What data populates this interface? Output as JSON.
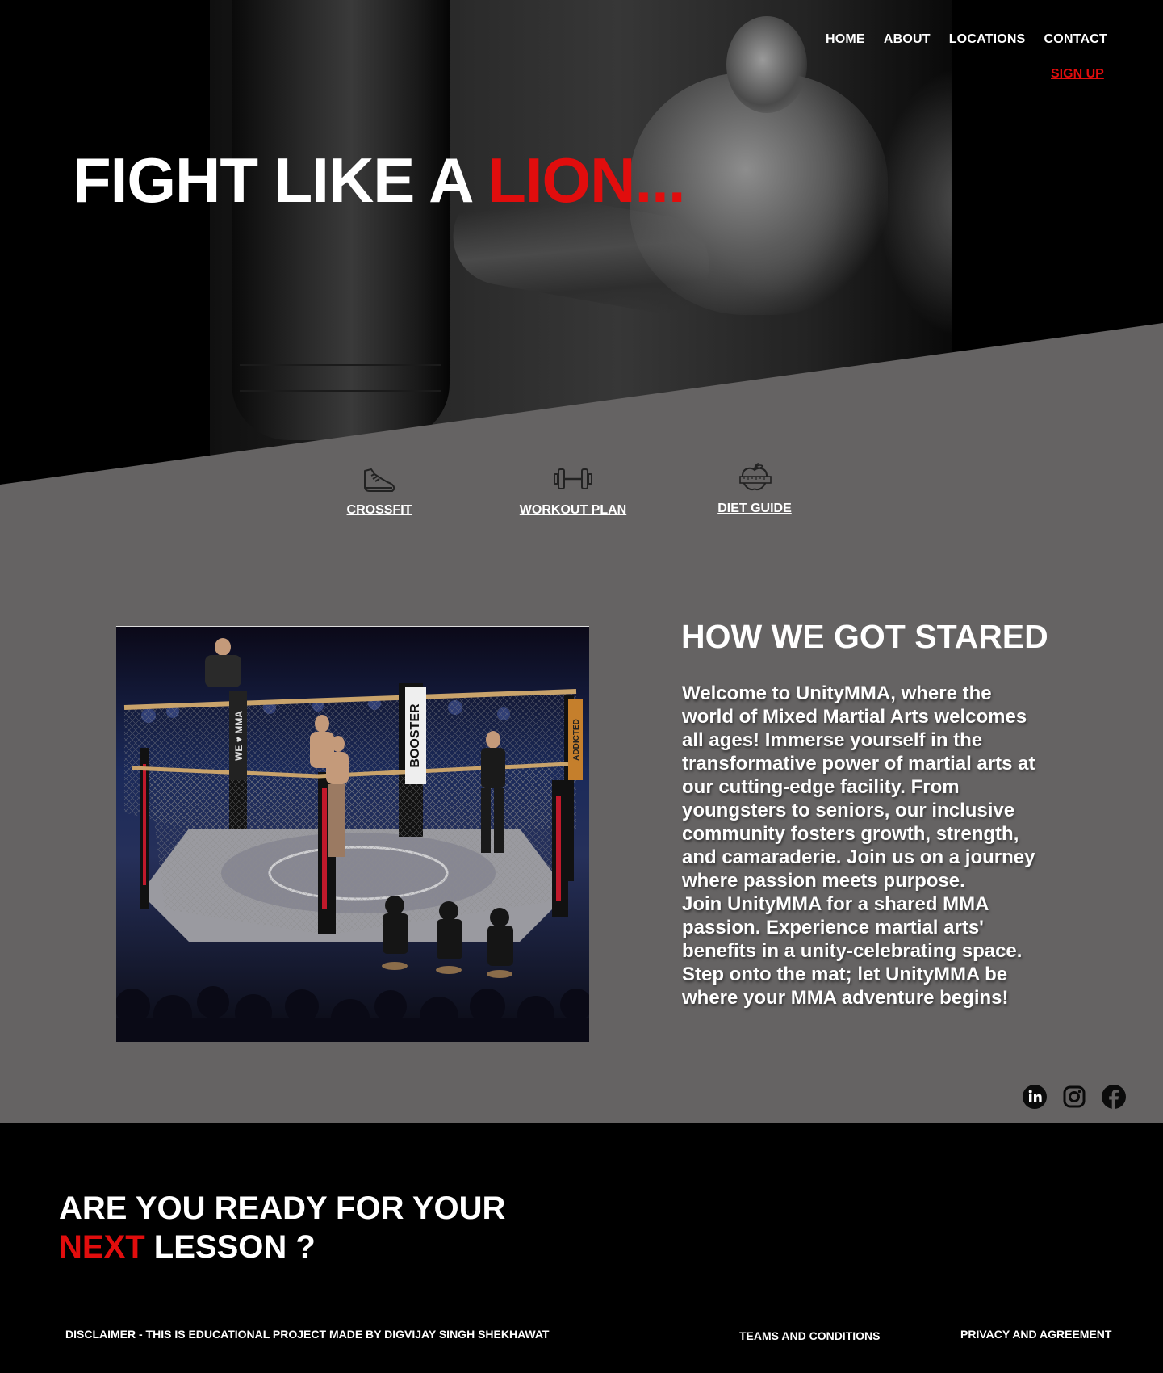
{
  "nav": {
    "items": [
      "HOME",
      "ABOUT",
      "LOCATIONS",
      "CONTACT"
    ],
    "signup": "SIGN UP"
  },
  "hero": {
    "title_white": "FIGHT LIKE A ",
    "title_red": "LION..."
  },
  "features": [
    {
      "label": "CROSSFIT",
      "icon": "running-shoe-icon"
    },
    {
      "label": "WORKOUT PLAN",
      "icon": "dumbbell-icon"
    },
    {
      "label": "DIET GUIDE",
      "icon": "apple-measuring-tape-icon"
    }
  ],
  "story": {
    "title": "HOW WE GOT STARED",
    "paragraph1": "Welcome to UnityMMA, where the world of Mixed Martial Arts welcomes all ages! Immerse yourself in the transformative power of martial arts at our cutting-edge facility. From youngsters to seniors, our inclusive community fosters growth, strength, and camaraderie. Join us on a journey where passion meets purpose.",
    "paragraph2": "Join UnityMMA for a shared MMA passion. Experience martial arts' benefits in a unity-celebrating space. Step onto the mat; let UnityMMA be where your MMA adventure begins!",
    "image_signage": [
      "BOOSTER",
      "WE ♥ MMA",
      "ADDICTED"
    ]
  },
  "socials": [
    "linkedin-icon",
    "instagram-icon",
    "facebook-icon"
  ],
  "cta": {
    "line1": "ARE YOU READY FOR YOUR",
    "line2_red": "NEXT",
    "line2_white": " LESSON ?"
  },
  "footer": {
    "disclaimer": "DISCLAIMER - THIS IS EDUCATIONAL PROJECT MADE BY DIGVIJAY SINGH SHEKHAWAT",
    "terms": "TEAMS AND CONDITIONS",
    "privacy": "PRIVACY AND AGREEMENT"
  },
  "colors": {
    "accent_red": "#e10d0d",
    "grey_section": "#656363",
    "dark": "#000000"
  }
}
